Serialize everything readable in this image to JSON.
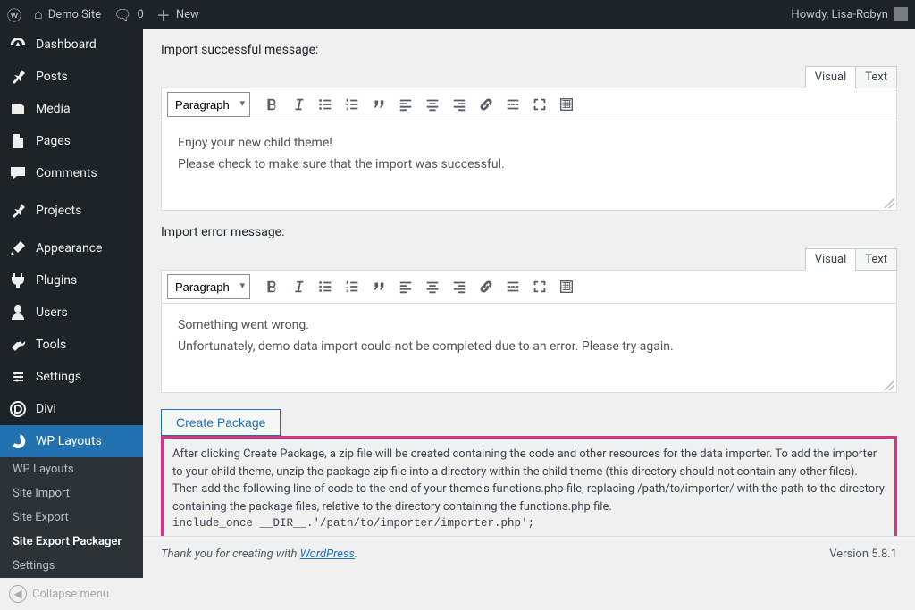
{
  "adminbar": {
    "site_name": "Demo Site",
    "comment_count": "0",
    "new_label": "New",
    "howdy": "Howdy, Lisa-Robyn"
  },
  "menu": {
    "items": [
      {
        "icon": "dashboard",
        "label": "Dashboard"
      },
      {
        "icon": "pin",
        "label": "Posts"
      },
      {
        "icon": "media",
        "label": "Media"
      },
      {
        "icon": "page",
        "label": "Pages"
      },
      {
        "icon": "comment",
        "label": "Comments"
      },
      {
        "icon": "pin",
        "label": "Projects"
      },
      {
        "icon": "brush",
        "label": "Appearance"
      },
      {
        "icon": "plugin",
        "label": "Plugins"
      },
      {
        "icon": "user",
        "label": "Users"
      },
      {
        "icon": "wrench",
        "label": "Tools"
      },
      {
        "icon": "settings",
        "label": "Settings"
      },
      {
        "icon": "divi",
        "label": "Divi"
      },
      {
        "icon": "layouts",
        "label": "WP Layouts"
      }
    ],
    "submenu": [
      {
        "label": "WP Layouts"
      },
      {
        "label": "Site Import"
      },
      {
        "label": "Site Export"
      },
      {
        "label": "Site Export Packager"
      },
      {
        "label": "Settings"
      }
    ],
    "collapse": "Collapse menu"
  },
  "editors": {
    "success_label": "Import successful message:",
    "error_label": "Import error message:",
    "visual_tab": "Visual",
    "text_tab": "Text",
    "format_option": "Paragraph",
    "success_body": {
      "l1": "Enjoy your new child theme!",
      "l2": "Please check to make sure that the import was successful."
    },
    "error_body": {
      "l1": "Something went wrong.",
      "l2": "Unfortunately, demo data import could not be completed due to an error. Please try again."
    }
  },
  "toolbar_buttons": [
    "bold",
    "italic",
    "ul",
    "ol",
    "quote",
    "align-left",
    "align-center",
    "align-right",
    "link",
    "more",
    "fullscreen",
    "kitchen"
  ],
  "action": {
    "create_label": "Create Package",
    "help": "After clicking Create Package, a zip file will be created containing the code and other resources for the data importer. To add the importer to your child theme, unzip the package zip file into a directory within the child theme (this directory should not contain any other files). Then add the following line of code to the end of your theme's functions.php file, replacing /path/to/importer/ with the path to the directory containing the package files, relative to the directory containing the functions.php file.",
    "code": "include_once __DIR__.'/path/to/importer/importer.php';"
  },
  "footer": {
    "thanks_pre": "Thank you for creating with ",
    "thanks_link": "WordPress",
    "thanks_post": ".",
    "version": "Version 5.8.1"
  }
}
